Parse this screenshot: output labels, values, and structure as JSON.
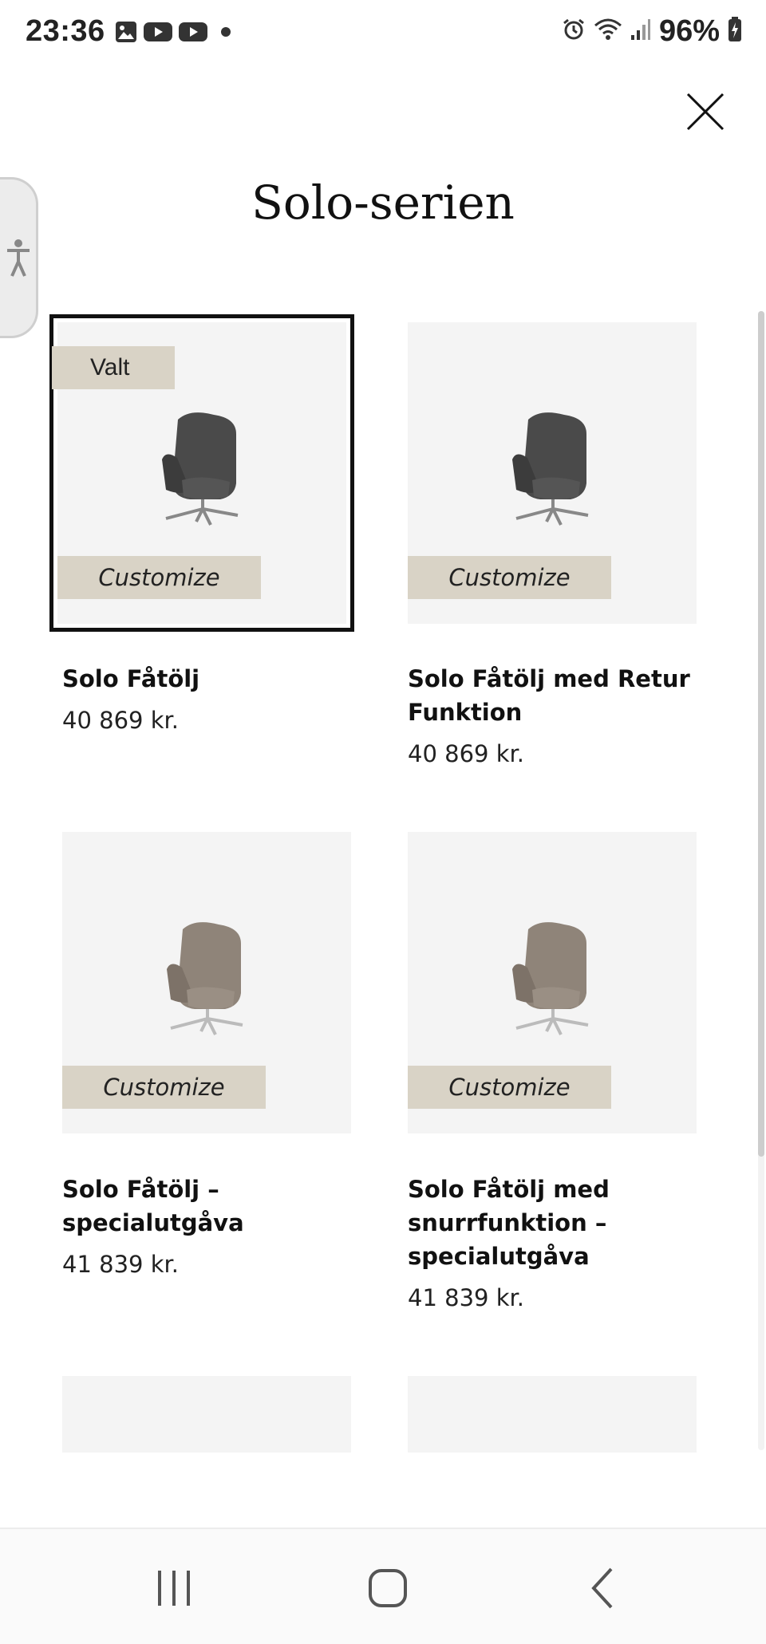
{
  "status_bar": {
    "time": "23:36",
    "battery": "96%",
    "left_icons": [
      "gallery-icon",
      "youtube-icon",
      "youtube-icon",
      "dot-icon"
    ],
    "right_icons": [
      "alarm-icon",
      "wifi-icon",
      "signal-icon",
      "battery-charging-icon"
    ]
  },
  "header": {
    "title": "Solo-serien",
    "close_icon": "close-icon"
  },
  "accessibility": {
    "icon": "accessibility-icon"
  },
  "products": [
    {
      "name": "Solo Fåtölj",
      "price": "40 869 kr.",
      "badge": "Valt",
      "action": "Customize",
      "selected": true,
      "chair_color": "#4a4a4a"
    },
    {
      "name": "Solo Fåtölj med Retur Funktion",
      "price": "40 869 kr.",
      "action": "Customize",
      "selected": false,
      "chair_color": "#4a4a4a"
    },
    {
      "name": "Solo Fåtölj – specialutgåva",
      "price": "41 839 kr.",
      "action": "Customize",
      "selected": false,
      "chair_color": "#8f8479"
    },
    {
      "name": "Solo Fåtölj med snurrfunktion – specialutgåva",
      "price": "41 839 kr.",
      "action": "Customize",
      "selected": false,
      "chair_color": "#8f8479"
    }
  ],
  "nav": {
    "recents": "recents-icon",
    "home": "home-icon",
    "back": "back-icon"
  },
  "colors": {
    "accent_tag": "#d9d3c6",
    "card_bg": "#f4f4f4"
  }
}
